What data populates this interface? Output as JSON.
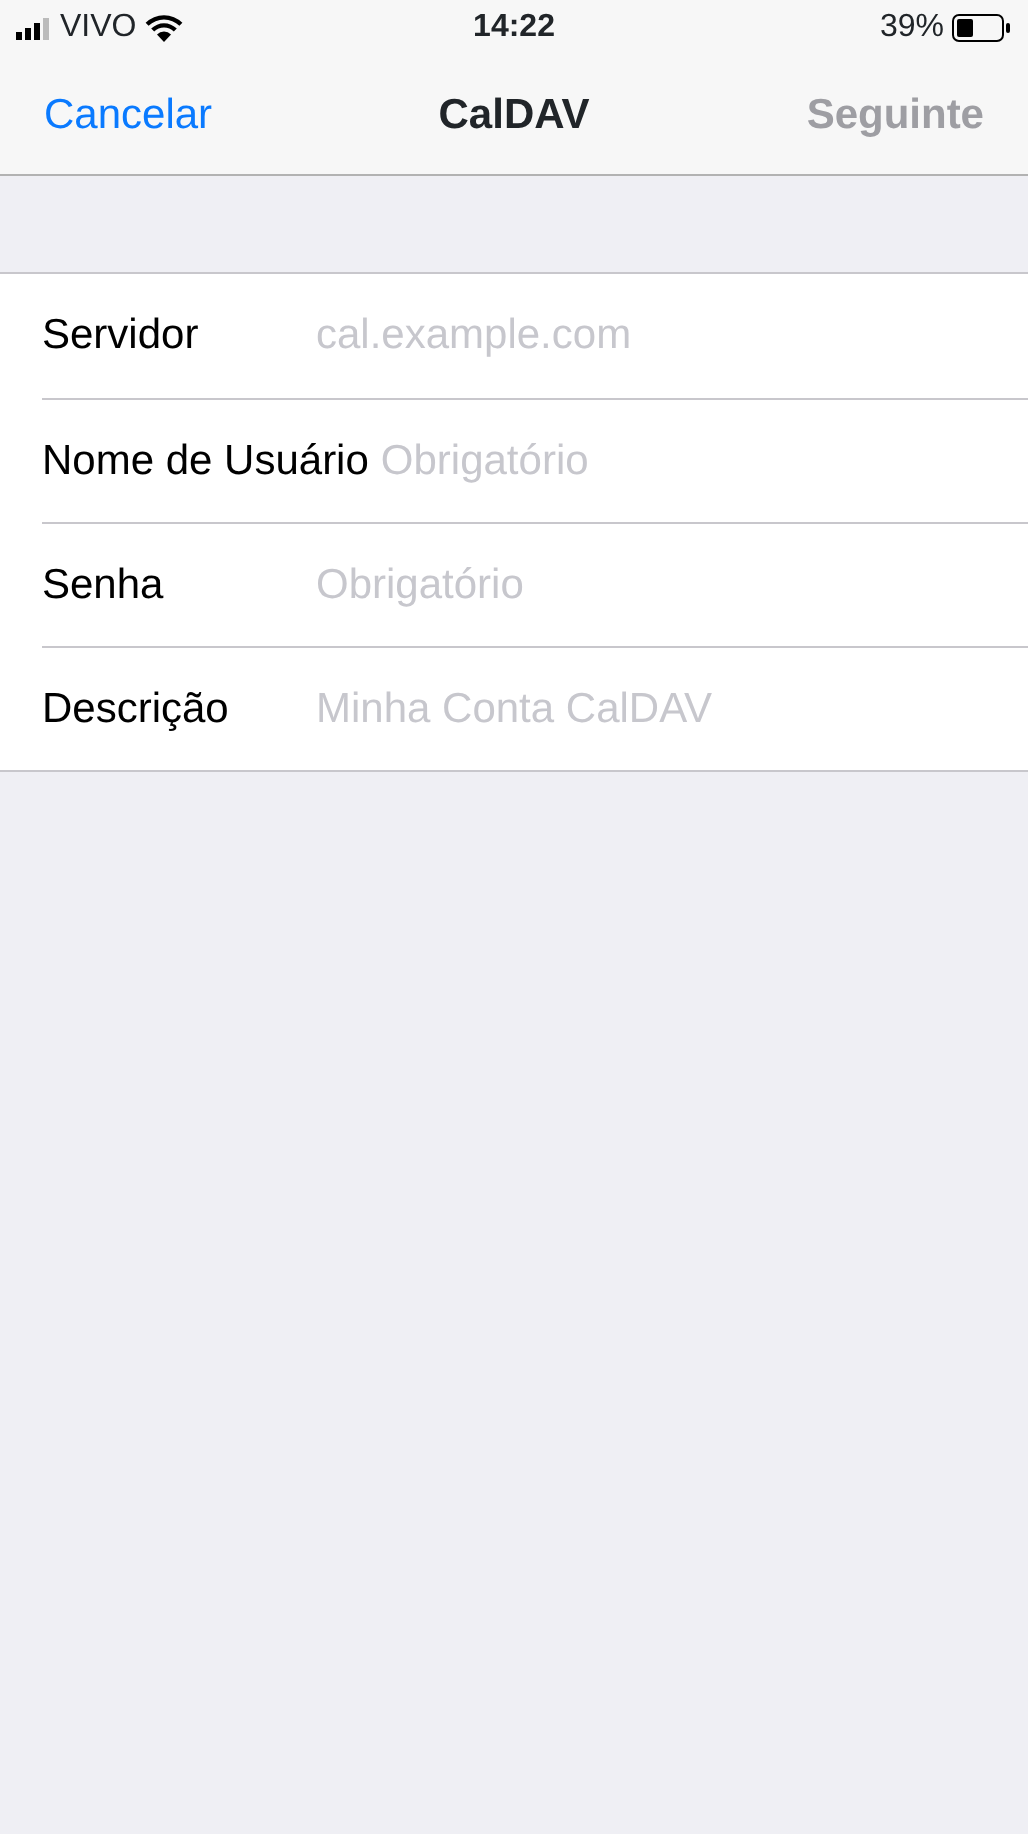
{
  "status_bar": {
    "carrier": "VIVO",
    "time": "14:22",
    "battery": "39%"
  },
  "nav": {
    "cancel": "Cancelar",
    "title": "CalDAV",
    "next": {
      "label": "Seguinte",
      "disabled": true
    }
  },
  "fields": [
    {
      "label": "Servidor",
      "placeholder": "cal.example.com"
    },
    {
      "label": "Nome de Usuário",
      "placeholder": "Obrigatório"
    },
    {
      "label": "Senha",
      "placeholder": "Obrigatório"
    },
    {
      "label": "Descrição",
      "placeholder": "Minha Conta CalDAV"
    }
  ]
}
